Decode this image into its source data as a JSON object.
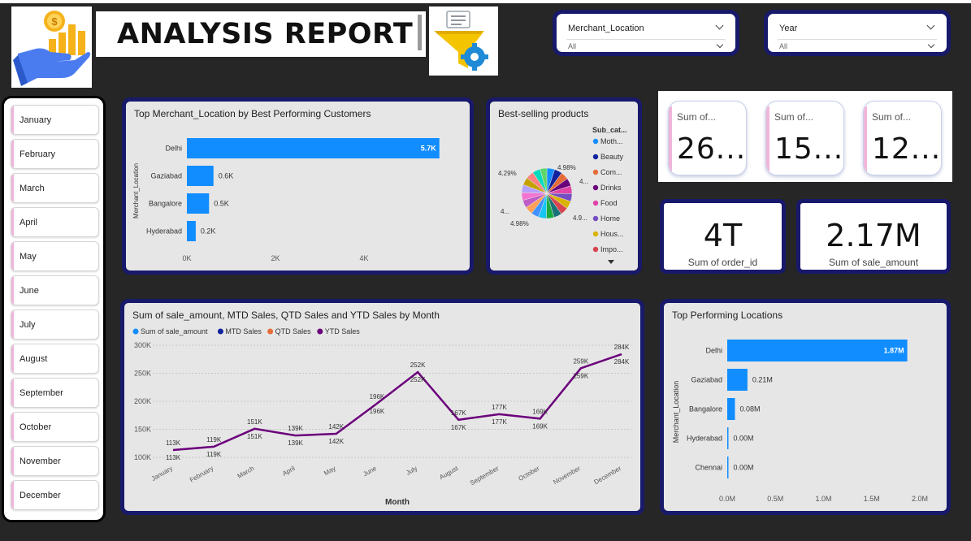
{
  "header": {
    "title": "ANALYSIS REPORT"
  },
  "slicers": {
    "merchant": {
      "title": "Merchant_Location",
      "value": "All"
    },
    "year": {
      "title": "Year",
      "value": "All"
    }
  },
  "months": [
    "January",
    "February",
    "March",
    "April",
    "May",
    "June",
    "July",
    "August",
    "September",
    "October",
    "November",
    "December"
  ],
  "kpis": {
    "small": [
      {
        "label": "Sum of...",
        "value": "26..."
      },
      {
        "label": "Sum of...",
        "value": "15..."
      },
      {
        "label": "Sum of...",
        "value": "12..."
      }
    ],
    "orders": {
      "value": "4T",
      "label": "Sum of order_id"
    },
    "sales": {
      "value": "2.17M",
      "label": "Sum of sale_amount"
    }
  },
  "colors": {
    "card_border": "#18196b",
    "bar": "#118dff",
    "line": "#6b007b",
    "legend": [
      "#118dff",
      "#12239e",
      "#e66c37",
      "#6b007b"
    ]
  },
  "chart_data": [
    {
      "type": "bar",
      "orientation": "horizontal",
      "title": "Top Merchant_Location by Best Performing Customers",
      "ylabel": "Merchant_Location",
      "categories": [
        "Delhi",
        "Gaziabad",
        "Bangalore",
        "Hyderabad"
      ],
      "values": [
        5700,
        600,
        500,
        200
      ],
      "data_labels": [
        "5.7K",
        "0.6K",
        "0.5K",
        "0.2K"
      ],
      "x_ticks": [
        0,
        2000,
        4000
      ],
      "x_tick_labels": [
        "0K",
        "2K",
        "4K"
      ],
      "xlim": [
        0,
        6200
      ]
    },
    {
      "type": "pie",
      "title": "Best-selling products",
      "legend_title": "Sub_cat...",
      "legend": [
        "Moth...",
        "Beauty",
        "Com...",
        "Drinks",
        "Food",
        "Home",
        "Hous...",
        "Impo..."
      ],
      "slice_colors": [
        "#118dff",
        "#12239e",
        "#e66c37",
        "#6b007b",
        "#e044a7",
        "#744ec2",
        "#d9b300",
        "#d64550",
        "#197278",
        "#1aab40",
        "#15c6f4",
        "#4092ff",
        "#ffa058",
        "#be5dc9",
        "#f472d0",
        "#b5a1ff",
        "#c4a200",
        "#ff8080",
        "#00dbbc",
        "#5bd667"
      ],
      "values": [
        4.98,
        4.98,
        4.98,
        4.98,
        4.98,
        4.98,
        4.98,
        4.98,
        4.98,
        4.98,
        4.98,
        4.98,
        4.98,
        4.98,
        4.98,
        4.98,
        4.98,
        4.98,
        4.98,
        4.29
      ],
      "data_labels": [
        "4.98%",
        "4...",
        "4.9...",
        "4.98%",
        "4...",
        "4.29%"
      ]
    },
    {
      "type": "line",
      "title": "Sum of sale_amount, MTD Sales, QTD Sales and YTD Sales by Month",
      "xlabel": "Month",
      "ylabel": "",
      "legend": [
        "Sum of sale_amount",
        "MTD Sales",
        "QTD Sales",
        "YTD Sales"
      ],
      "categories": [
        "January",
        "February",
        "March",
        "April",
        "May",
        "June",
        "July",
        "August",
        "September",
        "October",
        "November",
        "December"
      ],
      "series": [
        {
          "name": "Sum of sale_amount",
          "values": [
            113000,
            119000,
            151000,
            139000,
            142000,
            196000,
            252000,
            167000,
            177000,
            169000,
            259000,
            284000
          ]
        },
        {
          "name": "MTD Sales",
          "values": [
            113000,
            119000,
            151000,
            139000,
            142000,
            196000,
            252000,
            167000,
            177000,
            169000,
            259000,
            284000
          ]
        },
        {
          "name": "QTD Sales",
          "values": [
            113000,
            119000,
            151000,
            139000,
            142000,
            196000,
            252000,
            167000,
            177000,
            169000,
            259000,
            284000
          ]
        },
        {
          "name": "YTD Sales",
          "values": [
            113000,
            119000,
            151000,
            139000,
            142000,
            196000,
            252000,
            167000,
            177000,
            169000,
            259000,
            284000
          ]
        }
      ],
      "point_labels": [
        "113K",
        "119K",
        "151K",
        "139K",
        "142K",
        "196K",
        "252K",
        "167K",
        "177K",
        "169K",
        "259K",
        "284K"
      ],
      "y_ticks": [
        100000,
        150000,
        200000,
        250000,
        300000
      ],
      "y_tick_labels": [
        "100K",
        "150K",
        "200K",
        "250K",
        "300K"
      ],
      "ylim": [
        100000,
        300000
      ],
      "grid": true
    },
    {
      "type": "bar",
      "orientation": "horizontal",
      "title": "Top Performing Locations",
      "ylabel": "Merchant_Location",
      "categories": [
        "Delhi",
        "Gaziabad",
        "Bangalore",
        "Hyderabad",
        "Chennai"
      ],
      "values": [
        1870000,
        210000,
        80000,
        0,
        0
      ],
      "data_labels": [
        "1.87M",
        "0.21M",
        "0.08M",
        "0.00M",
        "0.00M"
      ],
      "x_ticks": [
        0,
        500000,
        1000000,
        1500000,
        2000000
      ],
      "x_tick_labels": [
        "0.0M",
        "0.5M",
        "1.0M",
        "1.5M",
        "2.0M"
      ],
      "xlim": [
        0,
        2000000
      ]
    }
  ]
}
